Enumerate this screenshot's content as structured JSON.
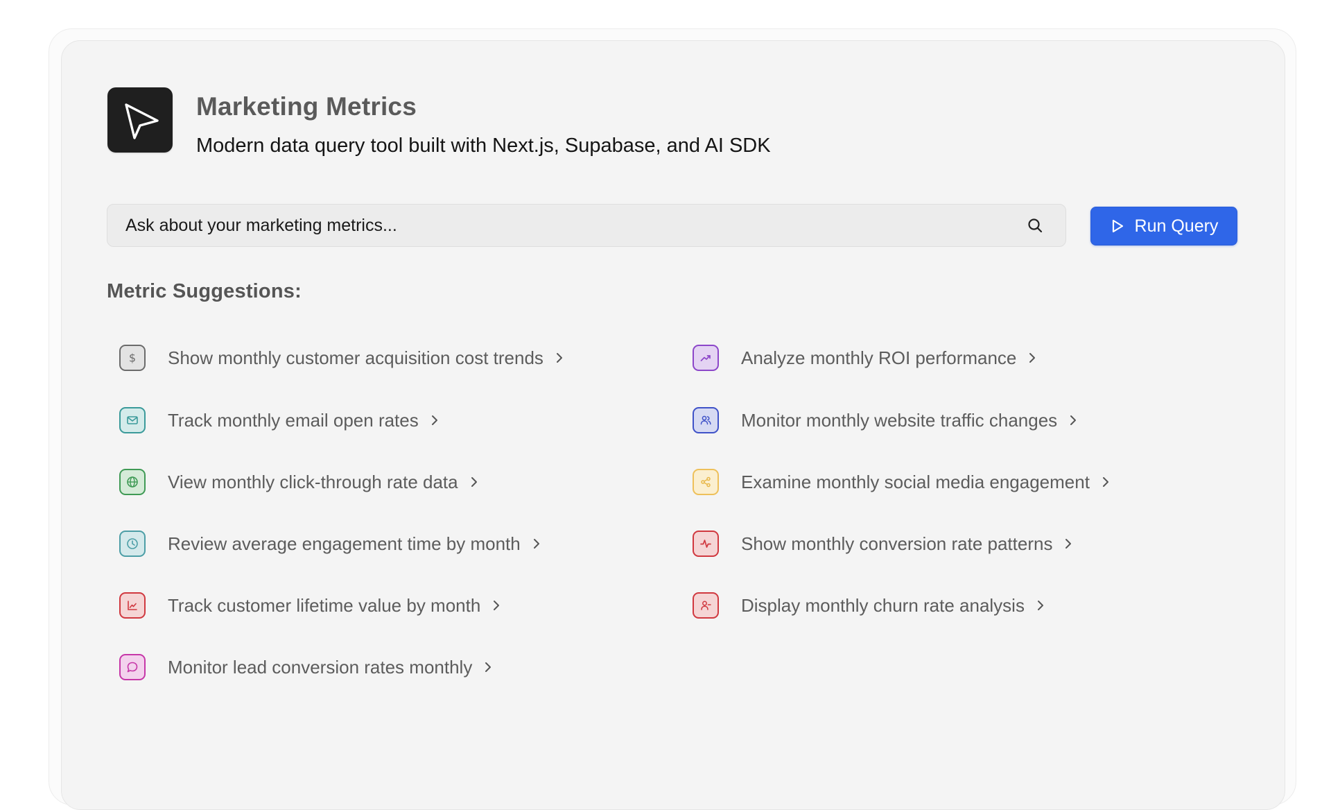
{
  "app": {
    "title": "Marketing Metrics",
    "subtitle": "Modern data query tool built with Next.js, Supabase, and AI SDK",
    "logo_icon": "cursor-arrow-icon"
  },
  "search": {
    "placeholder": "Ask about your marketing metrics...",
    "value": "",
    "icon": "search-icon"
  },
  "run_button": {
    "label": "Run Query",
    "icon": "play-icon",
    "color": "#2f66e8"
  },
  "suggestions": {
    "heading": "Metric Suggestions:",
    "left": [
      {
        "label": "Show monthly customer acquisition cost trends",
        "icon": "dollar-icon",
        "color": "#6b6b6b",
        "bg": "#e6e6e6"
      },
      {
        "label": "Track monthly email open rates",
        "icon": "mail-icon",
        "color": "#3a9a9a",
        "bg": "#d6ecec"
      },
      {
        "label": "View monthly click-through rate data",
        "icon": "globe-icon",
        "color": "#3f9a55",
        "bg": "#d7ecd9"
      },
      {
        "label": "Review average engagement time by month",
        "icon": "clock-icon",
        "color": "#4c9ea6",
        "bg": "#d6eaec"
      },
      {
        "label": "Track customer lifetime value by month",
        "icon": "line-chart-icon",
        "color": "#d0383f",
        "bg": "#f6d6d6"
      },
      {
        "label": "Monitor lead conversion rates monthly",
        "icon": "message-icon",
        "color": "#c637a8",
        "bg": "#f4d4ee"
      }
    ],
    "right": [
      {
        "label": "Analyze monthly ROI performance",
        "icon": "trending-up-icon",
        "color": "#8c46c9",
        "bg": "#e6d6f4"
      },
      {
        "label": "Monitor monthly website traffic changes",
        "icon": "users-icon",
        "color": "#3f52c8",
        "bg": "#d8dcf4"
      },
      {
        "label": "Examine monthly social media engagement",
        "icon": "share-icon",
        "color": "#e8b84a",
        "bg": "#fbefd0"
      },
      {
        "label": "Show monthly conversion rate patterns",
        "icon": "activity-icon",
        "color": "#d0383f",
        "bg": "#f6d6d6"
      },
      {
        "label": "Display monthly churn rate analysis",
        "icon": "user-minus-icon",
        "color": "#d0383f",
        "bg": "#f6d6d6"
      }
    ]
  }
}
